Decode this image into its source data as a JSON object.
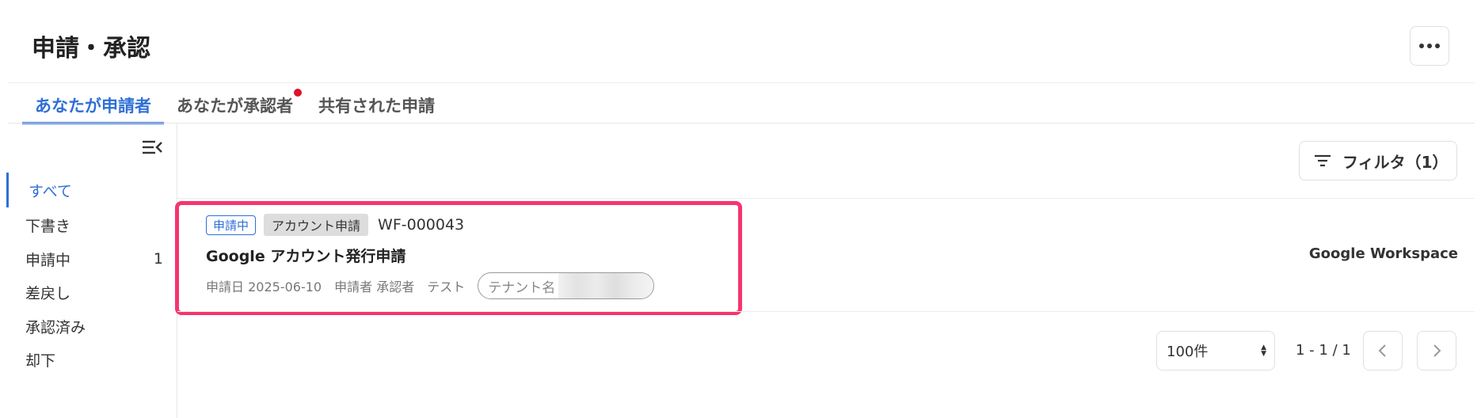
{
  "header": {
    "title": "申請・承認"
  },
  "tabs": [
    {
      "label": "あなたが申請者",
      "active": true,
      "notification": false
    },
    {
      "label": "あなたが承認者",
      "active": false,
      "notification": true
    },
    {
      "label": "共有された申請",
      "active": false,
      "notification": false
    }
  ],
  "sidebar": {
    "items": [
      {
        "label": "すべて",
        "active": true,
        "count": ""
      },
      {
        "label": "下書き",
        "active": false,
        "count": ""
      },
      {
        "label": "申請中",
        "active": false,
        "count": "1"
      },
      {
        "label": "差戻し",
        "active": false,
        "count": ""
      },
      {
        "label": "承認済み",
        "active": false,
        "count": ""
      },
      {
        "label": "却下",
        "active": false,
        "count": ""
      }
    ]
  },
  "toolbar": {
    "filter_label": "フィルタ（1）"
  },
  "requests": [
    {
      "status": "申請中",
      "type": "アカウント申請",
      "id": "WF-000043",
      "title": "Google アカウント発行申請",
      "date_label": "申請日",
      "date": "2025-06-10",
      "applicant_label": "申請者",
      "applicant": "承認者　テスト",
      "tenant_label": "テナント名",
      "service": "Google Workspace"
    }
  ],
  "pagination": {
    "per_page": "100件",
    "range": "1 - 1 / 1"
  },
  "colors": {
    "accent": "#2f6fd6",
    "highlight": "#f5356f",
    "notification": "#e0102a"
  }
}
